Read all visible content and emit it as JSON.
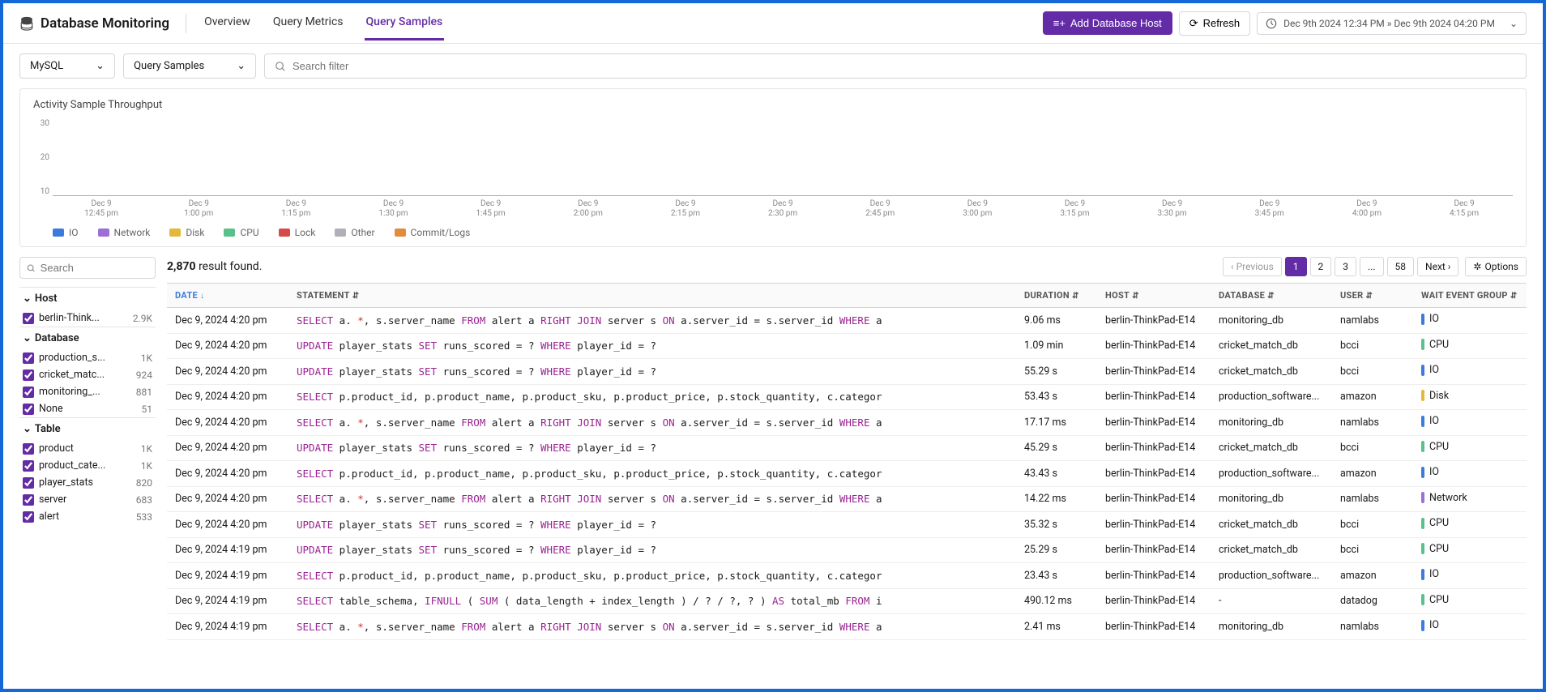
{
  "header": {
    "title": "Database Monitoring",
    "tabs": [
      "Overview",
      "Query Metrics",
      "Query Samples"
    ],
    "active_tab": 2,
    "add_host": "Add Database Host",
    "refresh": "Refresh",
    "time_range": "Dec 9th 2024 12:34 PM » Dec 9th 2024 04:20 PM"
  },
  "filters": {
    "engine": "MySQL",
    "view": "Query Samples",
    "search_placeholder": "Search filter"
  },
  "chart_data": {
    "type": "bar",
    "title": "Activity Sample Throughput",
    "ylim": [
      0,
      30
    ],
    "yticks": [
      30,
      20,
      10
    ],
    "categories": [
      "Dec 9 12:45 pm",
      "Dec 9 1:00 pm",
      "Dec 9 1:15 pm",
      "Dec 9 1:30 pm",
      "Dec 9 1:45 pm",
      "Dec 9 2:00 pm",
      "Dec 9 2:15 pm",
      "Dec 9 2:30 pm",
      "Dec 9 2:45 pm",
      "Dec 9 3:00 pm",
      "Dec 9 3:15 pm",
      "Dec 9 3:30 pm",
      "Dec 9 3:45 pm",
      "Dec 9 4:00 pm",
      "Dec 9 4:15 pm"
    ],
    "series": [
      {
        "name": "IO",
        "color": "#3b7bdd"
      },
      {
        "name": "Network",
        "color": "#9b6fd6"
      },
      {
        "name": "Disk",
        "color": "#e2b93b"
      },
      {
        "name": "CPU",
        "color": "#58c08a"
      },
      {
        "name": "Lock",
        "color": "#d64a4a"
      },
      {
        "name": "Other",
        "color": "#b0b0b8"
      },
      {
        "name": "Commit/Logs",
        "color": "#e28b3b"
      }
    ],
    "note": "stacked bar histogram ~150 bins, typical total 12-18, IO dominant ~8-12, CPU ~2-4, Network ~1-2, occasional Disk/Commit spikes near 12:45pm"
  },
  "sidebar": {
    "search_placeholder": "Search",
    "facets": [
      {
        "name": "Host",
        "items": [
          {
            "label": "berlin-Think...",
            "count": "2.9K",
            "checked": true
          }
        ]
      },
      {
        "name": "Database",
        "items": [
          {
            "label": "production_s...",
            "count": "1K",
            "checked": true
          },
          {
            "label": "cricket_matc...",
            "count": "924",
            "checked": true
          },
          {
            "label": "monitoring_...",
            "count": "881",
            "checked": true
          },
          {
            "label": "None",
            "count": "51",
            "checked": true
          }
        ]
      },
      {
        "name": "Table",
        "items": [
          {
            "label": "product",
            "count": "1K",
            "checked": true
          },
          {
            "label": "product_cate...",
            "count": "1K",
            "checked": true
          },
          {
            "label": "player_stats",
            "count": "820",
            "checked": true
          },
          {
            "label": "server",
            "count": "683",
            "checked": true
          },
          {
            "label": "alert",
            "count": "533",
            "checked": true
          }
        ]
      }
    ]
  },
  "results": {
    "count": "2,870",
    "suffix": "result found.",
    "pages": {
      "prev": "‹ Previous",
      "items": [
        "1",
        "2",
        "3",
        "...",
        "58"
      ],
      "next": "Next ›",
      "active": 0
    },
    "options": "Options",
    "columns": [
      "DATE",
      "STATEMENT",
      "DURATION",
      "HOST",
      "DATABASE",
      "USER",
      "WAIT EVENT GROUP"
    ],
    "rows": [
      {
        "date": "Dec 9, 2024 4:20 pm",
        "stmt": [
          [
            "kw",
            "SELECT"
          ],
          [
            "",
            " a. "
          ],
          [
            "op",
            "*"
          ],
          [
            "",
            ", s.server_name "
          ],
          [
            "kw",
            "FROM"
          ],
          [
            "",
            " alert a "
          ],
          [
            "kw",
            "RIGHT JOIN"
          ],
          [
            "",
            " server s "
          ],
          [
            "kw",
            "ON"
          ],
          [
            "",
            " a.server_id = s.server_id "
          ],
          [
            "kw",
            "WHERE"
          ],
          [
            "",
            " a"
          ]
        ],
        "dur": "9.06 ms",
        "host": "berlin-ThinkPad-E14",
        "db": "monitoring_db",
        "user": "namlabs",
        "wait": "IO",
        "wc": "c-io"
      },
      {
        "date": "Dec 9, 2024 4:20 pm",
        "stmt": [
          [
            "kw",
            "UPDATE"
          ],
          [
            "",
            " player_stats "
          ],
          [
            "kw",
            "SET"
          ],
          [
            "",
            " runs_scored = ? "
          ],
          [
            "kw",
            "WHERE"
          ],
          [
            "",
            " player_id = ?"
          ]
        ],
        "dur": "1.09 min",
        "host": "berlin-ThinkPad-E14",
        "db": "cricket_match_db",
        "user": "bcci",
        "wait": "CPU",
        "wc": "c-cpu"
      },
      {
        "date": "Dec 9, 2024 4:20 pm",
        "stmt": [
          [
            "kw",
            "UPDATE"
          ],
          [
            "",
            " player_stats "
          ],
          [
            "kw",
            "SET"
          ],
          [
            "",
            " runs_scored = ? "
          ],
          [
            "kw",
            "WHERE"
          ],
          [
            "",
            " player_id = ?"
          ]
        ],
        "dur": "55.29 s",
        "host": "berlin-ThinkPad-E14",
        "db": "cricket_match_db",
        "user": "bcci",
        "wait": "IO",
        "wc": "c-io"
      },
      {
        "date": "Dec 9, 2024 4:20 pm",
        "stmt": [
          [
            "kw",
            "SELECT"
          ],
          [
            "",
            " p.product_id, p.product_name, p.product_sku, p.product_price, p.stock_quantity, c.categor"
          ]
        ],
        "dur": "53.43 s",
        "host": "berlin-ThinkPad-E14",
        "db": "production_software...",
        "user": "amazon",
        "wait": "Disk",
        "wc": "c-disk"
      },
      {
        "date": "Dec 9, 2024 4:20 pm",
        "stmt": [
          [
            "kw",
            "SELECT"
          ],
          [
            "",
            " a. "
          ],
          [
            "op",
            "*"
          ],
          [
            "",
            ", s.server_name "
          ],
          [
            "kw",
            "FROM"
          ],
          [
            "",
            " alert a "
          ],
          [
            "kw",
            "RIGHT JOIN"
          ],
          [
            "",
            " server s "
          ],
          [
            "kw",
            "ON"
          ],
          [
            "",
            " a.server_id = s.server_id "
          ],
          [
            "kw",
            "WHERE"
          ],
          [
            "",
            " a"
          ]
        ],
        "dur": "17.17 ms",
        "host": "berlin-ThinkPad-E14",
        "db": "monitoring_db",
        "user": "namlabs",
        "wait": "IO",
        "wc": "c-io"
      },
      {
        "date": "Dec 9, 2024 4:20 pm",
        "stmt": [
          [
            "kw",
            "UPDATE"
          ],
          [
            "",
            " player_stats "
          ],
          [
            "kw",
            "SET"
          ],
          [
            "",
            " runs_scored = ? "
          ],
          [
            "kw",
            "WHERE"
          ],
          [
            "",
            " player_id = ?"
          ]
        ],
        "dur": "45.29 s",
        "host": "berlin-ThinkPad-E14",
        "db": "cricket_match_db",
        "user": "bcci",
        "wait": "CPU",
        "wc": "c-cpu"
      },
      {
        "date": "Dec 9, 2024 4:20 pm",
        "stmt": [
          [
            "kw",
            "SELECT"
          ],
          [
            "",
            " p.product_id, p.product_name, p.product_sku, p.product_price, p.stock_quantity, c.categor"
          ]
        ],
        "dur": "43.43 s",
        "host": "berlin-ThinkPad-E14",
        "db": "production_software...",
        "user": "amazon",
        "wait": "IO",
        "wc": "c-io"
      },
      {
        "date": "Dec 9, 2024 4:20 pm",
        "stmt": [
          [
            "kw",
            "SELECT"
          ],
          [
            "",
            " a. "
          ],
          [
            "op",
            "*"
          ],
          [
            "",
            ", s.server_name "
          ],
          [
            "kw",
            "FROM"
          ],
          [
            "",
            " alert a "
          ],
          [
            "kw",
            "RIGHT JOIN"
          ],
          [
            "",
            " server s "
          ],
          [
            "kw",
            "ON"
          ],
          [
            "",
            " a.server_id = s.server_id "
          ],
          [
            "kw",
            "WHERE"
          ],
          [
            "",
            " a"
          ]
        ],
        "dur": "14.22 ms",
        "host": "berlin-ThinkPad-E14",
        "db": "monitoring_db",
        "user": "namlabs",
        "wait": "Network",
        "wc": "c-network"
      },
      {
        "date": "Dec 9, 2024 4:20 pm",
        "stmt": [
          [
            "kw",
            "UPDATE"
          ],
          [
            "",
            " player_stats "
          ],
          [
            "kw",
            "SET"
          ],
          [
            "",
            " runs_scored = ? "
          ],
          [
            "kw",
            "WHERE"
          ],
          [
            "",
            " player_id = ?"
          ]
        ],
        "dur": "35.32 s",
        "host": "berlin-ThinkPad-E14",
        "db": "cricket_match_db",
        "user": "bcci",
        "wait": "CPU",
        "wc": "c-cpu"
      },
      {
        "date": "Dec 9, 2024 4:19 pm",
        "stmt": [
          [
            "kw",
            "UPDATE"
          ],
          [
            "",
            " player_stats "
          ],
          [
            "kw",
            "SET"
          ],
          [
            "",
            " runs_scored = ? "
          ],
          [
            "kw",
            "WHERE"
          ],
          [
            "",
            " player_id = ?"
          ]
        ],
        "dur": "25.29 s",
        "host": "berlin-ThinkPad-E14",
        "db": "cricket_match_db",
        "user": "bcci",
        "wait": "CPU",
        "wc": "c-cpu"
      },
      {
        "date": "Dec 9, 2024 4:19 pm",
        "stmt": [
          [
            "kw",
            "SELECT"
          ],
          [
            "",
            " p.product_id, p.product_name, p.product_sku, p.product_price, p.stock_quantity, c.categor"
          ]
        ],
        "dur": "23.43 s",
        "host": "berlin-ThinkPad-E14",
        "db": "production_software...",
        "user": "amazon",
        "wait": "IO",
        "wc": "c-io"
      },
      {
        "date": "Dec 9, 2024 4:19 pm",
        "stmt": [
          [
            "kw",
            "SELECT"
          ],
          [
            "",
            " table_schema, "
          ],
          [
            "kw",
            "IFNULL"
          ],
          [
            "",
            " ( "
          ],
          [
            "kw",
            "SUM"
          ],
          [
            "",
            " ( data_length + index_length ) / ? / ?, ? ) "
          ],
          [
            "kw",
            "AS"
          ],
          [
            "",
            " total_mb "
          ],
          [
            "kw",
            "FROM"
          ],
          [
            "",
            " i"
          ]
        ],
        "dur": "490.12 ms",
        "host": "berlin-ThinkPad-E14",
        "db": "-",
        "user": "datadog",
        "wait": "CPU",
        "wc": "c-cpu"
      },
      {
        "date": "Dec 9, 2024 4:19 pm",
        "stmt": [
          [
            "kw",
            "SELECT"
          ],
          [
            "",
            " a. "
          ],
          [
            "op",
            "*"
          ],
          [
            "",
            ", s.server_name "
          ],
          [
            "kw",
            "FROM"
          ],
          [
            "",
            " alert a "
          ],
          [
            "kw",
            "RIGHT JOIN"
          ],
          [
            "",
            " server s "
          ],
          [
            "kw",
            "ON"
          ],
          [
            "",
            " a.server_id = s.server_id "
          ],
          [
            "kw",
            "WHERE"
          ],
          [
            "",
            " a"
          ]
        ],
        "dur": "2.41 ms",
        "host": "berlin-ThinkPad-E14",
        "db": "monitoring_db",
        "user": "namlabs",
        "wait": "IO",
        "wc": "c-io"
      }
    ]
  }
}
